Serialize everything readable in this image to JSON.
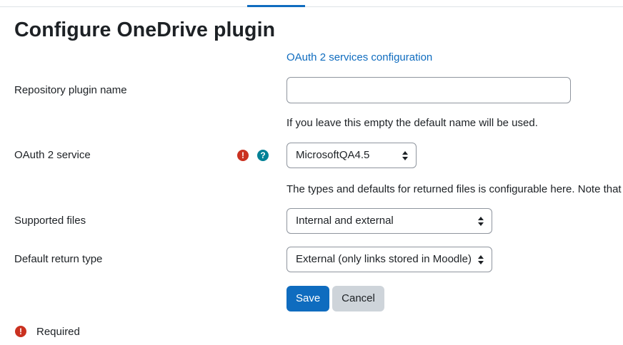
{
  "page": {
    "title": "Configure OneDrive plugin",
    "oauth_link": "OAuth 2 services configuration"
  },
  "form": {
    "plugin_name": {
      "label": "Repository plugin name",
      "value": "",
      "help": "If you leave this empty the default name will be used."
    },
    "oauth_service": {
      "label": "OAuth 2 service",
      "selected": "MicrosoftQA4.5",
      "required_icon": "exclamation-icon",
      "help_icon": "question-icon",
      "help": "The types and defaults for returned files is configurable here. Note that"
    },
    "supported_files": {
      "label": "Supported files",
      "selected": "Internal and external"
    },
    "return_type": {
      "label": "Default return type",
      "selected": "External (only links stored in Moodle)"
    },
    "buttons": {
      "save": "Save",
      "cancel": "Cancel"
    },
    "required_note": "Required"
  },
  "colors": {
    "primary": "#0f6cbf",
    "required": "#ca3120",
    "help": "#008196",
    "secondary_button": "#ced4da"
  }
}
